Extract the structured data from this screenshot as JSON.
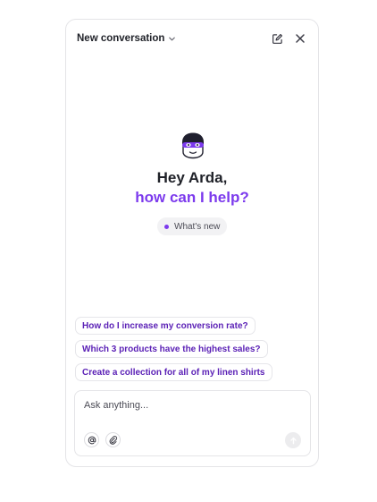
{
  "header": {
    "title": "New conversation",
    "icons": [
      "chevron-down-icon",
      "new-chat-icon",
      "close-icon"
    ]
  },
  "greeting": {
    "line1": "Hey Arda,",
    "line2": "how can I help?"
  },
  "whats_new": {
    "label": "What's new"
  },
  "suggestions": [
    "How do I increase my conversion rate?",
    "Which 3 products have the highest sales?",
    "Create a collection for all of my linen shirts"
  ],
  "composer": {
    "placeholder": "Ask anything...",
    "tools": [
      "mention-icon",
      "attach-icon"
    ],
    "send_icon": "send-icon"
  },
  "colors": {
    "accent": "#7c3aed",
    "suggestion_text": "#5b21b6",
    "border": "#e4e4e7",
    "text": "#1f2128"
  }
}
